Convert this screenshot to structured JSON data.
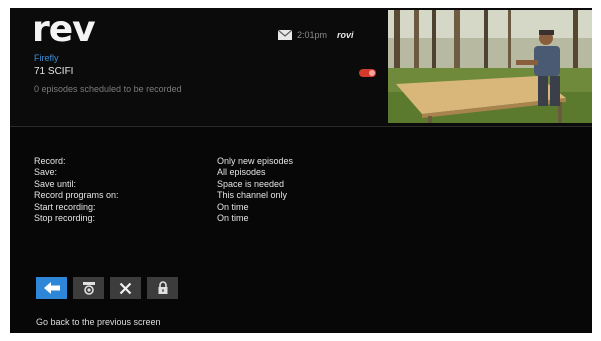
{
  "app": {
    "logo": "rev",
    "brand": "rovi"
  },
  "status": {
    "time": "2:01pm"
  },
  "program": {
    "title": "Firefly",
    "channel": "71 SCIFI",
    "schedule_note": "0 episodes scheduled to be recorded"
  },
  "settings": [
    {
      "label": "Record:",
      "value": "Only new episodes"
    },
    {
      "label": "Save:",
      "value": "All episodes"
    },
    {
      "label": "Save until:",
      "value": "Space is needed"
    },
    {
      "label": "Record programs on:",
      "value": "This channel only"
    },
    {
      "label": "Start recording:",
      "value": "On time"
    },
    {
      "label": "Stop recording:",
      "value": "On time"
    }
  ],
  "toolbar": {
    "buttons": [
      {
        "icon": "back-arrow-icon",
        "state": "selected"
      },
      {
        "icon": "schedule-record-icon"
      },
      {
        "icon": "close-icon"
      },
      {
        "icon": "lock-icon"
      }
    ]
  },
  "hint": "Go back to the previous screen",
  "colors": {
    "accent": "#2d86d7",
    "title_blue": "#3d8fd8",
    "record_red": "#d43a2c",
    "background": "#070707"
  }
}
